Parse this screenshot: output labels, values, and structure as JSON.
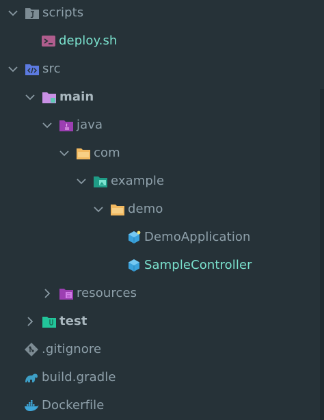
{
  "tree": {
    "scripts": "scripts",
    "deploy": "deploy.sh",
    "src": "src",
    "main": "main",
    "java": "java",
    "com": "com",
    "example": "example",
    "demo": "demo",
    "demo_application": "DemoApplication",
    "sample_controller": "SampleController",
    "resources": "resources",
    "test": "test",
    "gitignore": ".gitignore",
    "build_gradle": "build.gradle",
    "dockerfile": "Dockerfile"
  },
  "colors": {
    "background": "#263238",
    "text": "#8fa1ab",
    "selected_text": "#7be3cf",
    "chevron": "#8a9aa3"
  }
}
